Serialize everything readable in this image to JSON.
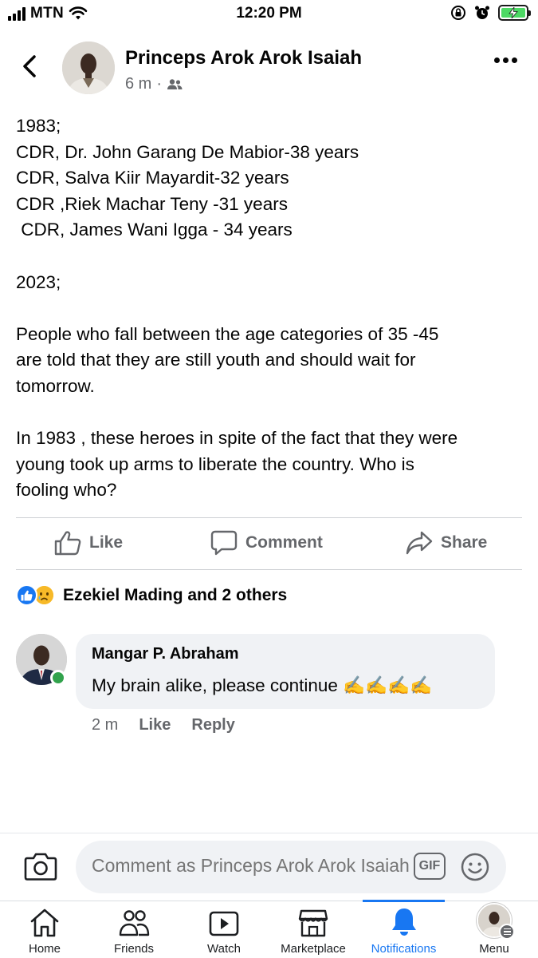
{
  "status_bar": {
    "carrier": "MTN",
    "time": "12:20 PM",
    "battery_color": "#4cd964",
    "icons": [
      "signal-icon",
      "wifi-icon",
      "orientation-lock-icon",
      "alarm-icon",
      "battery-charging-icon"
    ]
  },
  "post": {
    "author": "Princeps Arok Arok Isaiah",
    "time": "6 m",
    "separator": "·",
    "audience_icon": "friends-icon",
    "paragraphs": [
      [
        "1983;",
        "CDR, Dr. John Garang De Mabior-38 years",
        "CDR, Salva Kiir Mayardit-32 years",
        "CDR ,Riek Machar Teny -31 years",
        " CDR, James Wani Igga - 34 years"
      ],
      [
        "2023;"
      ],
      [
        "People who fall between the age categories of 35 -45",
        "are told that they are still youth and should wait for",
        "tomorrow."
      ],
      [
        "In 1983 , these heroes in spite of the fact that they were",
        "young took up arms to liberate the country. Who is",
        "fooling who?"
      ]
    ]
  },
  "actions": {
    "like": "Like",
    "comment": "Comment",
    "share": "Share"
  },
  "reactions": {
    "text": "Ezekiel Mading and 2 others",
    "types": [
      "like",
      "sad"
    ],
    "like_color": "#1877f2",
    "sad_color": "#f7b928"
  },
  "comment": {
    "name": "Mangar P. Abraham",
    "text": "My brain alike,  please continue ✍️✍️✍️✍️",
    "time": "2 m",
    "like": "Like",
    "reply": "Reply",
    "online_color": "#31a24c"
  },
  "composer": {
    "placeholder": "Comment as Princeps Arok Arok Isaiah",
    "gif": "GIF"
  },
  "tabs": [
    {
      "label": "Home",
      "icon": "home-icon"
    },
    {
      "label": "Friends",
      "icon": "friends-icon"
    },
    {
      "label": "Watch",
      "icon": "watch-icon"
    },
    {
      "label": "Marketplace",
      "icon": "marketplace-icon"
    },
    {
      "label": "Notifications",
      "icon": "bell-icon",
      "active": true
    },
    {
      "label": "Menu",
      "icon": "profile-avatar"
    }
  ],
  "accent_color": "#1877f2"
}
